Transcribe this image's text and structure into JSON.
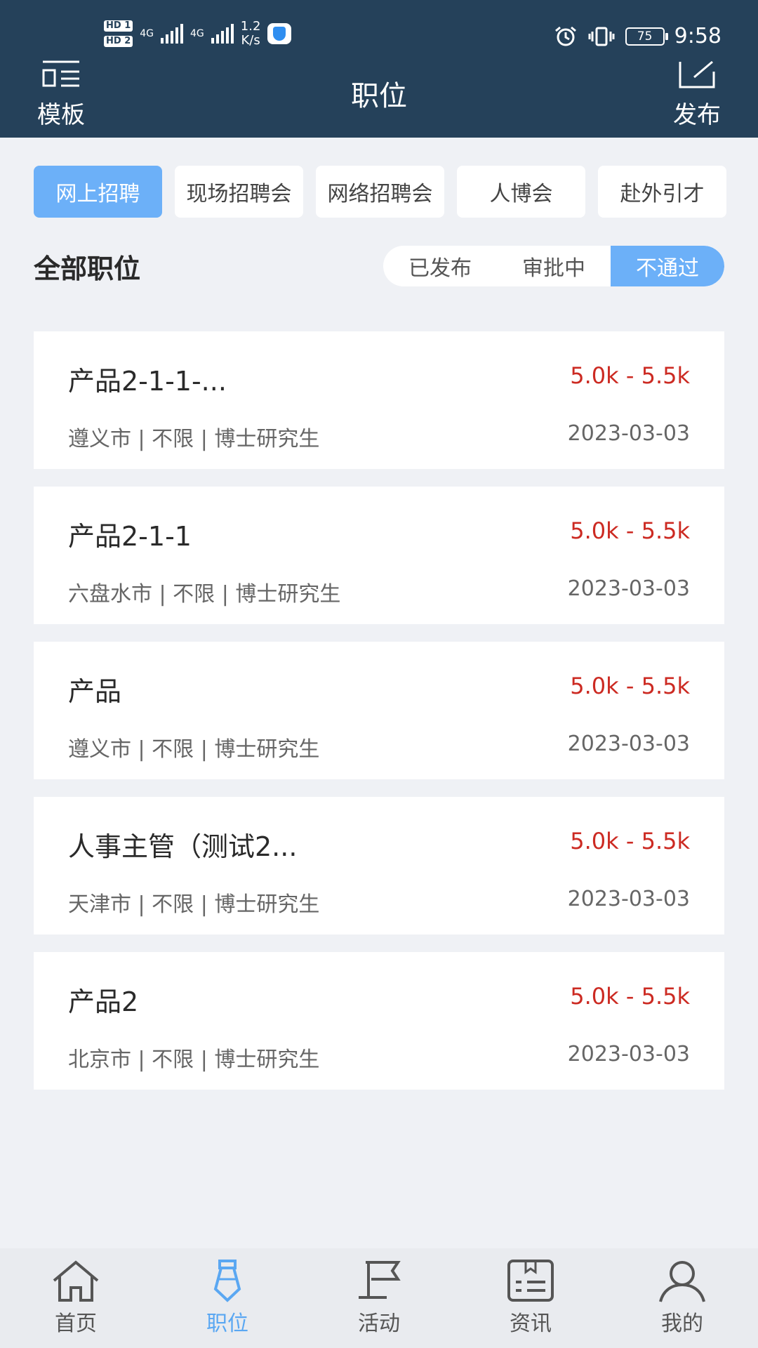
{
  "status_bar": {
    "sim1": "HD 1",
    "sim2": "HD 2",
    "network": "4G",
    "speed": "1.2",
    "speed_unit": "K/s",
    "battery": "75",
    "time": "9:58"
  },
  "header": {
    "left_label": "模板",
    "title": "职位",
    "right_label": "发布"
  },
  "tabs": [
    {
      "label": "网上招聘",
      "active": true
    },
    {
      "label": "现场招聘会",
      "active": false
    },
    {
      "label": "网络招聘会",
      "active": false
    },
    {
      "label": "人博会",
      "active": false
    },
    {
      "label": "赴外引才",
      "active": false
    }
  ],
  "section": {
    "title": "全部职位"
  },
  "filter": [
    {
      "label": "已发布",
      "active": false
    },
    {
      "label": "审批中",
      "active": false
    },
    {
      "label": "不通过",
      "active": true
    }
  ],
  "jobs": [
    {
      "title": "产品2-1-1-...",
      "salary": "5.0k - 5.5k",
      "meta": "遵义市 | 不限 | 博士研究生",
      "date": "2023-03-03"
    },
    {
      "title": "产品2-1-1",
      "salary": "5.0k - 5.5k",
      "meta": "六盘水市 | 不限 | 博士研究生",
      "date": "2023-03-03"
    },
    {
      "title": "产品",
      "salary": "5.0k - 5.5k",
      "meta": "遵义市 | 不限 | 博士研究生",
      "date": "2023-03-03"
    },
    {
      "title": "人事主管（测试2...",
      "salary": "5.0k - 5.5k",
      "meta": "天津市 | 不限 | 博士研究生",
      "date": "2023-03-03"
    },
    {
      "title": "产品2",
      "salary": "5.0k - 5.5k",
      "meta": "北京市 | 不限 | 博士研究生",
      "date": "2023-03-03"
    }
  ],
  "bottom_nav": [
    {
      "label": "首页",
      "icon": "home-icon",
      "active": false
    },
    {
      "label": "职位",
      "icon": "tie-icon",
      "active": true
    },
    {
      "label": "活动",
      "icon": "flag-icon",
      "active": false
    },
    {
      "label": "资讯",
      "icon": "news-icon",
      "active": false
    },
    {
      "label": "我的",
      "icon": "user-icon",
      "active": false
    }
  ],
  "colors": {
    "header_bg": "#25415a",
    "accent": "#6cb0f8",
    "salary": "#cc2a22",
    "background": "#eff1f5"
  }
}
